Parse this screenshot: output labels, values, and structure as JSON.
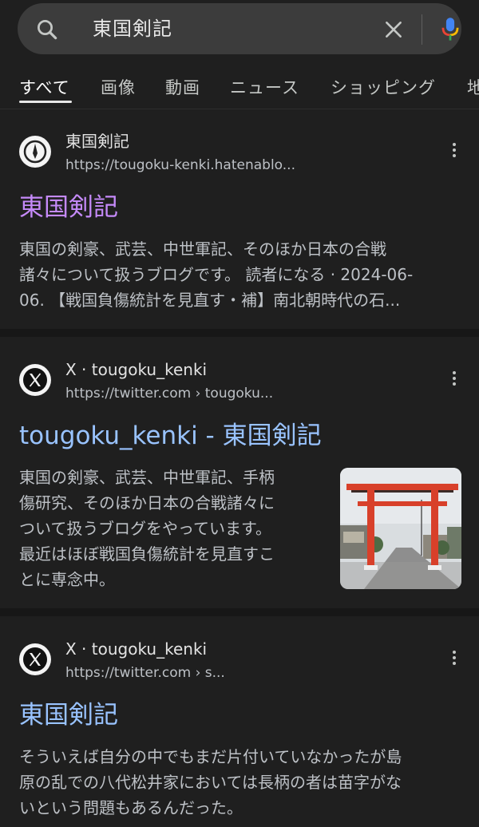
{
  "search": {
    "query": "東国剣記",
    "search_icon": "search-icon",
    "clear_icon": "close-icon",
    "mic_icon": "microphone-icon"
  },
  "tabs": [
    {
      "label": "すべて",
      "active": true
    },
    {
      "label": "画像"
    },
    {
      "label": "動画"
    },
    {
      "label": "ニュース"
    },
    {
      "label": "ショッピング"
    },
    {
      "label": "地"
    }
  ],
  "results": [
    {
      "site_name": "東国剣記",
      "url": "https://tougoku-kenki.hatenablo...",
      "favicon": "hatena-blog-icon",
      "title": "東国剣記",
      "title_color": "#c58af9",
      "snippet_lines": [
        "東国の剣豪、武芸、中世軍記、そのほか日本の合戦",
        "諸々について扱うブログです。 読者になる · 2024-06-",
        "06. 【戦国負傷統計を見直す・補】南北朝時代の石..."
      ]
    },
    {
      "site_name": "X · tougoku_kenki",
      "url": "https://twitter.com › tougoku...",
      "favicon": "x-logo-icon",
      "title": "tougoku_kenki - 東国剣記",
      "title_color": "#99c3ff",
      "snippet_lines": [
        "東国の剣豪、武芸、中世軍記、手柄",
        "傷研究、そのほか日本の合戦諸々に",
        "ついて扱うブログをやっています。",
        "最近はほぼ戦国負傷統計を見直すこ",
        "とに専念中。"
      ],
      "thumbnail": "torii-gate-photo"
    },
    {
      "site_name": "X · tougoku_kenki",
      "url": "https://twitter.com › s...",
      "favicon": "x-logo-icon",
      "title": "東国剣記",
      "title_color": "#99c3ff",
      "snippet_lines": [
        "そういえば自分の中でもまだ片付いていなかったが島",
        "原の乱での八代松井家においては長柄の者は苗字がな",
        "いという問題もあるんだった。"
      ]
    }
  ]
}
